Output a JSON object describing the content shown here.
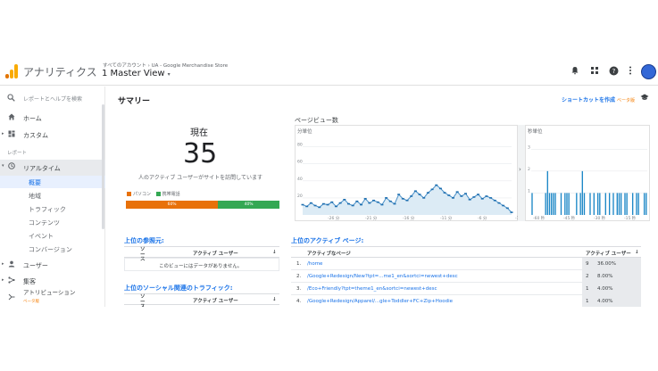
{
  "header": {
    "app_title": "アナリティクス",
    "breadcrumb": "すべてのアカウント › UA - Google Merchandise Store",
    "view_name": "1 Master View",
    "view_caret": "▾",
    "icons": [
      "bell-icon",
      "apps-icon",
      "help-icon",
      "more-vert-icon"
    ]
  },
  "colors": {
    "logo_orange": "#f9ab00",
    "logo_dark": "#e37400",
    "desktop": "#e8710a",
    "mobile": "#34a853",
    "link": "#1a73e8",
    "bar_blue": "#1e88c7"
  },
  "sidebar": {
    "search_placeholder": "レポートとヘルプを検索",
    "items": [
      {
        "label": "ホーム"
      },
      {
        "label": "カスタム"
      }
    ],
    "reports_label": "レポート",
    "realtime": {
      "label": "リアルタイム"
    },
    "realtime_children": [
      {
        "label": "概要"
      },
      {
        "label": "地域"
      },
      {
        "label": "トラフィック"
      },
      {
        "label": "コンテンツ"
      },
      {
        "label": "イベント"
      },
      {
        "label": "コンバージョン"
      }
    ],
    "bottom_items": [
      {
        "label": "ユーザー"
      },
      {
        "label": "集客"
      },
      {
        "label": "アトリビューション"
      }
    ],
    "attribution_beta": "ベータ版"
  },
  "summary": {
    "title": "サマリー",
    "shortcut": "ショートカットを作成",
    "shortcut_beta": "ベータ版"
  },
  "now": {
    "label": "現在",
    "count": "35",
    "desc": "人のアクティブ ユーザーがサイトを訪問しています",
    "legend_desktop": "パソコン",
    "legend_mobile": "携帯電話",
    "desktop_pct": "60%",
    "mobile_pct": "40%",
    "desktop_share": 0.6
  },
  "pageviews": {
    "title": "ページビュー数",
    "minute_label": "分単位",
    "second_label": "秒単位"
  },
  "chart_data": [
    {
      "type": "line",
      "title": "分単位",
      "y_ticks": [
        "80",
        "60",
        "40",
        "20"
      ],
      "x_labels": [
        "-26 分",
        "-21 分",
        "-16 分",
        "-11 分",
        "-6 分",
        "-1 分"
      ],
      "ylim": [
        0,
        90
      ],
      "values": [
        12,
        10,
        14,
        11,
        9,
        13,
        12,
        15,
        10,
        14,
        18,
        13,
        11,
        16,
        12,
        19,
        14,
        17,
        15,
        12,
        20,
        16,
        13,
        24,
        19,
        17,
        22,
        28,
        24,
        20,
        26,
        30,
        35,
        31,
        26,
        23,
        20,
        27,
        22,
        25,
        18,
        21,
        24,
        19,
        22,
        20,
        17,
        14,
        11,
        8,
        3
      ],
      "grid": true
    },
    {
      "type": "bar",
      "title": "秒単位",
      "y_ticks": [
        "3",
        "2",
        "1"
      ],
      "x_labels": [
        "-60 秒",
        "-45 秒",
        "-30 秒",
        "-15 秒"
      ],
      "ylim": [
        0,
        3.5
      ],
      "values": [
        1,
        0,
        0,
        0,
        0,
        0,
        0,
        1,
        2,
        1,
        1,
        1,
        1,
        0,
        0,
        1,
        0,
        1,
        1,
        1,
        0,
        0,
        0,
        1,
        0,
        1,
        2,
        1,
        0,
        0,
        1,
        0,
        1,
        0,
        1,
        1,
        0,
        0,
        1,
        0,
        1,
        0,
        1,
        0,
        1,
        1,
        1,
        0,
        1,
        1,
        0,
        0,
        1,
        0,
        1,
        1,
        0,
        0,
        1,
        1
      ],
      "grid": true
    }
  ],
  "referrals": {
    "title": "上位の参照元:",
    "col_source": "ソース",
    "col_users": "アクティブ ユーザー",
    "sort_icon": "↓",
    "empty_message": "このビューにはデータがありません。"
  },
  "social": {
    "title": "上位のソーシャル関連のトラフィック:",
    "col_source": "ソース",
    "col_users": "アクティブ ユーザー",
    "sort_icon": "↓"
  },
  "active_pages": {
    "title": "上位のアクティブ ページ:",
    "col_page": "アクティブなページ",
    "col_users": "アクティブ ユーザー",
    "sort_icon": "↓",
    "rows": [
      {
        "rank": "1.",
        "page": "/home",
        "users": "9",
        "pct": "36.00%",
        "share": 0.36
      },
      {
        "rank": "2.",
        "page": "/Google+Redesign/New?tpt=...me1_en&sortci=newest+desc",
        "users": "2",
        "pct": "8.00%",
        "share": 0.08
      },
      {
        "rank": "3.",
        "page": "/Eco+Friendly?tpt=theme1_en&sortci=newest+desc",
        "users": "1",
        "pct": "4.00%",
        "share": 0.04
      },
      {
        "rank": "4.",
        "page": "/Google+Redesign/Apparel/...gle+Toddler+FC+Zip+Hoodie",
        "users": "1",
        "pct": "4.00%",
        "share": 0.04
      }
    ]
  }
}
